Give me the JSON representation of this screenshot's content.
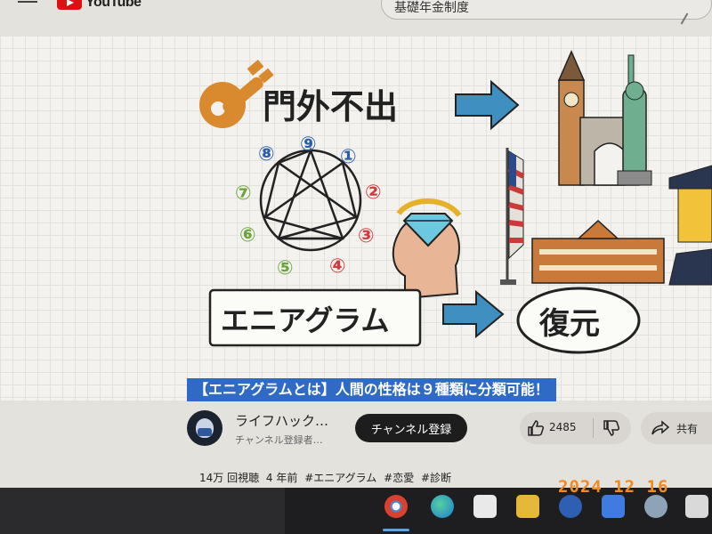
{
  "header": {
    "logo_text": "YouTube",
    "search_value": "基礎年金制度"
  },
  "thumbnail": {
    "heading": "門外不出",
    "enneagram_label": "エニアグラム",
    "restore_label": "復元",
    "numbers": [
      "⑨",
      "①",
      "②",
      "③",
      "④",
      "⑤",
      "⑥",
      "⑦",
      "⑧"
    ]
  },
  "video": {
    "title": "【エニアグラムとは】人間の性格は９種類に分類可能！"
  },
  "channel": {
    "name": "ライフハック…",
    "subscribers": "チャンネル登録者…",
    "subscribe_label": "チャンネル登録"
  },
  "actions": {
    "likes": "2485",
    "share_label": "共有"
  },
  "meta": {
    "views": "14万 回視聴",
    "age": "4 年前",
    "tags": [
      "#エニアグラム",
      "#恋愛",
      "#診断"
    ]
  },
  "photo_timestamp": "2024 12 16",
  "colors": {
    "accent_blue": "#2f6bc4",
    "subscribe_bg": "#1d1d1d",
    "timestamp": "#f08a24",
    "arrow": "#3f8fc0"
  }
}
